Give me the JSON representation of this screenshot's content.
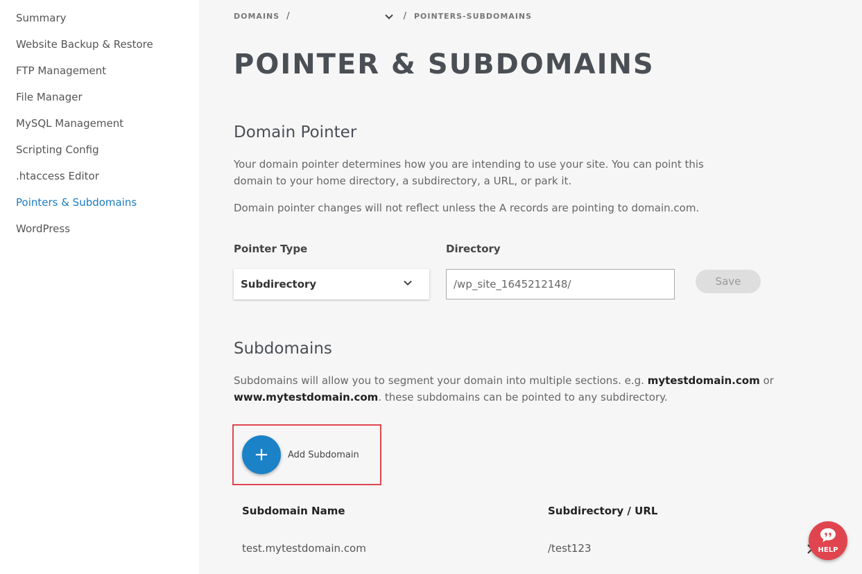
{
  "sidebar": {
    "items": [
      {
        "label": "Summary"
      },
      {
        "label": "Website Backup & Restore"
      },
      {
        "label": "FTP Management"
      },
      {
        "label": "File Manager"
      },
      {
        "label": "MySQL Management"
      },
      {
        "label": "Scripting Config"
      },
      {
        "label": ".htaccess Editor"
      },
      {
        "label": "Pointers & Subdomains"
      },
      {
        "label": "WordPress"
      }
    ],
    "active_index": 7
  },
  "breadcrumb": {
    "root": "DOMAINS",
    "separator": "/",
    "current": "POINTERS-SUBDOMAINS"
  },
  "page_title": "POINTER & SUBDOMAINS",
  "domain_pointer": {
    "title": "Domain Pointer",
    "description": "Your domain pointer determines how you are intending to use your site. You can point this domain to your home directory, a subdirectory, a URL, or park it.",
    "note": "Domain pointer changes will not reflect unless the A records are pointing to domain.com.",
    "pointer_type_label": "Pointer Type",
    "pointer_type_value": "Subdirectory",
    "directory_label": "Directory",
    "directory_value": "/wp_site_1645212148/",
    "save_label": "Save"
  },
  "subdomains": {
    "title": "Subdomains",
    "description_pre": "Subdomains will allow you to segment your domain into multiple sections. e.g. ",
    "example1": "mytestdomain.com",
    "description_mid": " or ",
    "example2": "www.mytestdomain.com",
    "description_post": ". these subdomains can be pointed to any subdirectory.",
    "add_label": "Add Subdomain",
    "add_icon": "+",
    "columns": [
      "Subdomain Name",
      "Subdirectory / URL"
    ],
    "rows": [
      {
        "name": "test.mytestdomain.com",
        "path": "/test123"
      }
    ]
  },
  "help": {
    "label": "HELP"
  },
  "colors": {
    "accent": "#1b82c7",
    "active_link": "#1a7cc1",
    "highlight": "#e0454f"
  }
}
